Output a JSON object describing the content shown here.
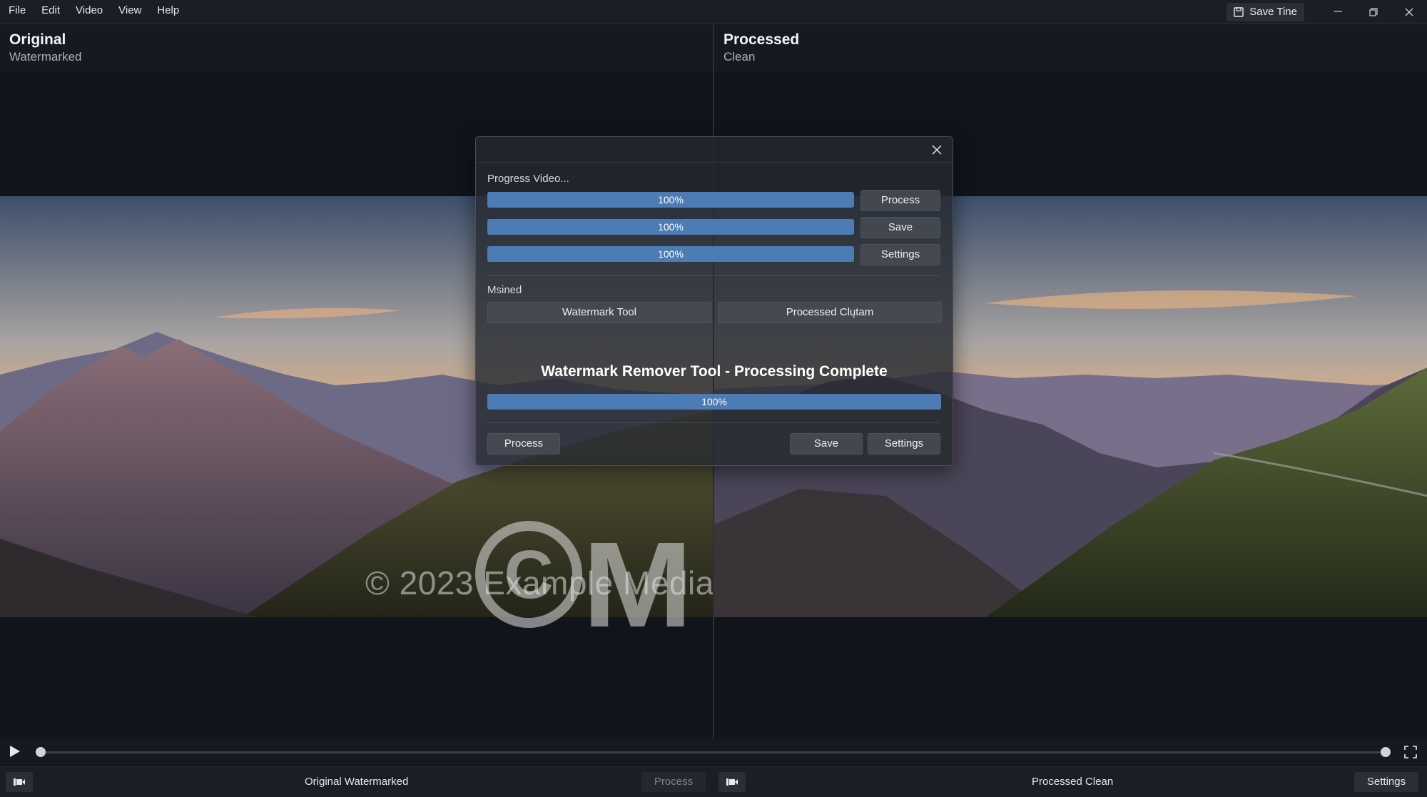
{
  "menu": [
    "File",
    "Edit",
    "Video",
    "View",
    "Help"
  ],
  "titlebar": {
    "save_label": "Save Tine"
  },
  "left_pane": {
    "title": "Original",
    "subtitle": "Watermarked"
  },
  "right_pane": {
    "title": "Processed",
    "subtitle": "Clean"
  },
  "watermark": {
    "text": "© 2023 Example Media"
  },
  "dialog": {
    "section1_label": "Progress Video...",
    "rows": [
      {
        "progress": "100%",
        "button": "Process"
      },
      {
        "progress": "100%",
        "button": "Save"
      },
      {
        "progress": "100%",
        "button": "Settings"
      }
    ],
    "section2_label": "Msined",
    "tool_buttons": [
      "Watermark Tool",
      "Processed Clųtam"
    ],
    "heading": "Watermark Remover Tool - Processing Complete",
    "overall_progress": "100%",
    "footer": {
      "process": "Process",
      "save": "Save",
      "settings": "Settings"
    }
  },
  "status": {
    "left_label": "Original Watermarked",
    "left_button": "Process",
    "right_label": "Processed Clean",
    "right_button": "Settings"
  },
  "colors": {
    "accent": "#4d7bb4",
    "background": "#10131a"
  }
}
